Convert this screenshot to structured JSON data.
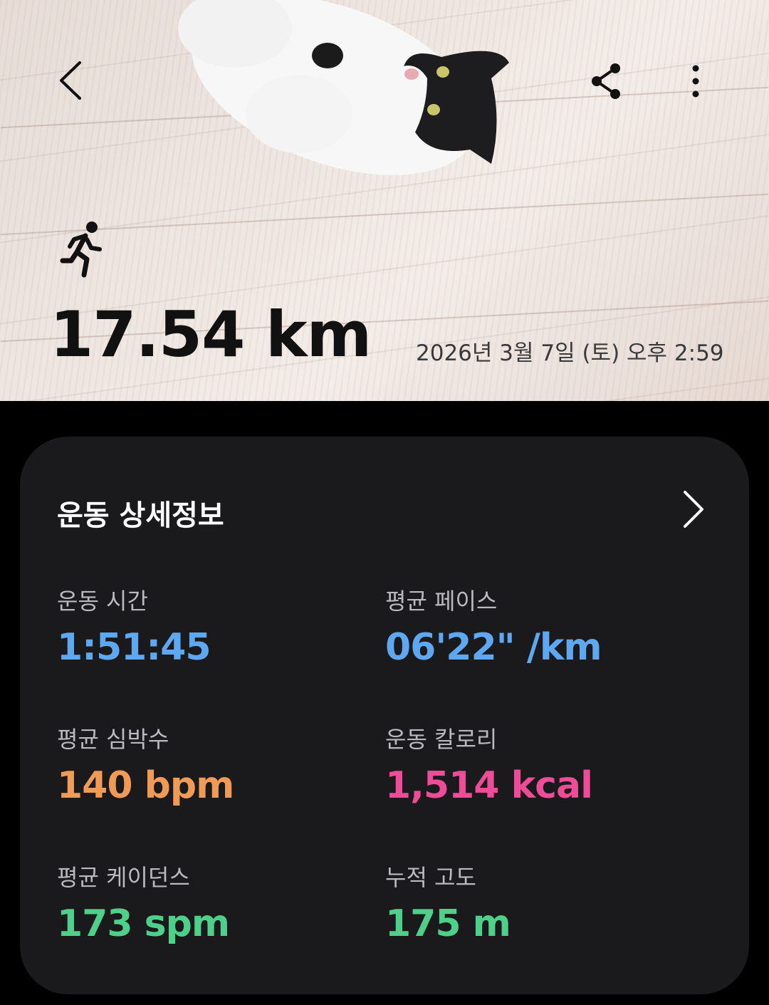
{
  "hero": {
    "distance": "17.54 km",
    "datetime": "2026년 3월 7일 (토) 오후 2:59",
    "activity_icon": "running-person-icon",
    "photo_subject": "cat-photo"
  },
  "toolbar": {
    "back_icon": "chevron-left-icon",
    "share_icon": "share-icon",
    "more_icon": "more-vertical-icon"
  },
  "details": {
    "title": "운동 상세정보",
    "chevron_icon": "chevron-right-icon",
    "stats": [
      {
        "label": "운동 시간",
        "value": "1:51:45",
        "color": "#5ea8f2"
      },
      {
        "label": "평균 페이스",
        "value": "06'22\" /km",
        "color": "#5ea8f2"
      },
      {
        "label": "평균 심박수",
        "value": "140 bpm",
        "color": "#ef9a55"
      },
      {
        "label": "운동 칼로리",
        "value": "1,514 kcal",
        "color": "#ef4c98"
      },
      {
        "label": "평균 케이던스",
        "value": "173 spm",
        "color": "#4fd08a"
      },
      {
        "label": "누적 고도",
        "value": "175 m",
        "color": "#4fd08a"
      }
    ]
  }
}
